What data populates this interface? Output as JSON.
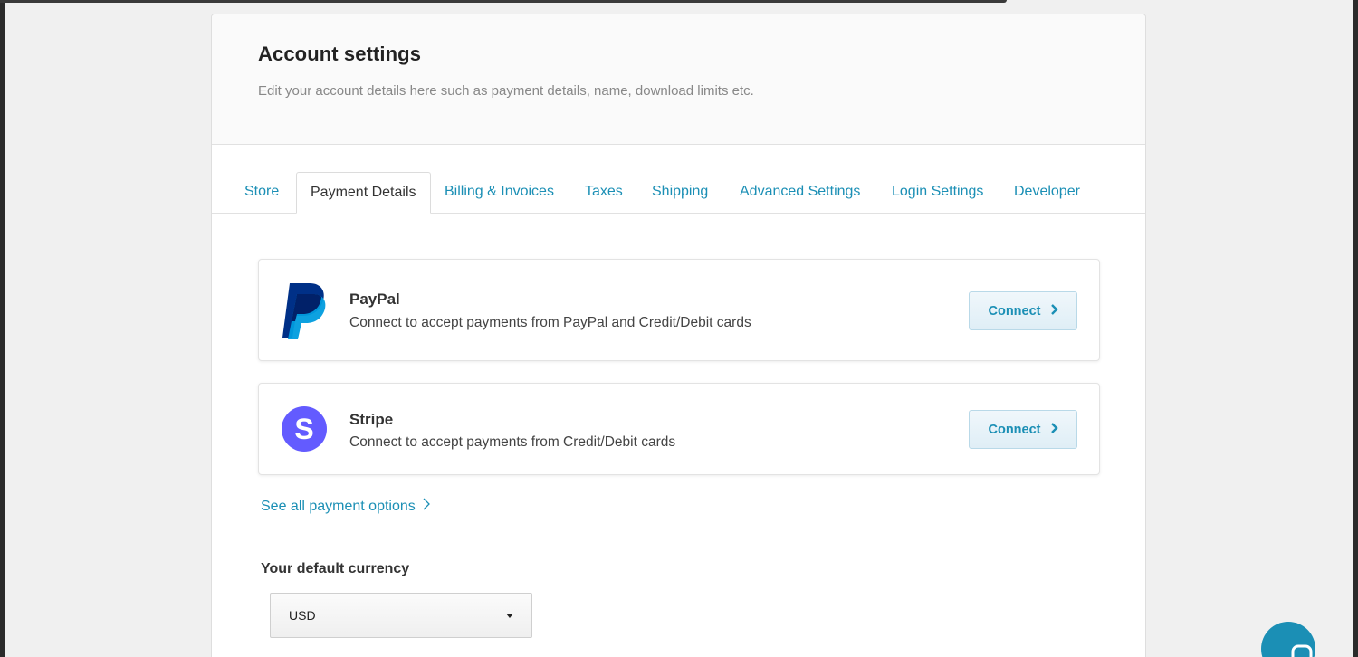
{
  "header": {
    "title": "Account settings",
    "subtitle": "Edit your account details here such as payment details, name, download limits etc."
  },
  "tabs": [
    {
      "label": "Store",
      "active": false
    },
    {
      "label": "Payment Details",
      "active": true
    },
    {
      "label": "Billing & Invoices",
      "active": false
    },
    {
      "label": "Taxes",
      "active": false
    },
    {
      "label": "Shipping",
      "active": false
    },
    {
      "label": "Advanced Settings",
      "active": false
    },
    {
      "label": "Login Settings",
      "active": false
    },
    {
      "label": "Developer",
      "active": false
    }
  ],
  "providers": [
    {
      "name": "PayPal",
      "description": "Connect to accept payments from PayPal and Credit/Debit cards",
      "button": "Connect",
      "icon": "paypal-logo-icon"
    },
    {
      "name": "Stripe",
      "description": "Connect to accept payments from Credit/Debit cards",
      "button": "Connect",
      "icon": "stripe-logo-icon"
    }
  ],
  "see_all_link": "See all payment options",
  "currency": {
    "label": "Your default currency",
    "selected": "USD"
  },
  "colors": {
    "accent": "#1b8fb5",
    "paypal_dark": "#003087",
    "paypal_light": "#009cde",
    "stripe": "#635bff"
  },
  "stripe_logo_letter": "S"
}
